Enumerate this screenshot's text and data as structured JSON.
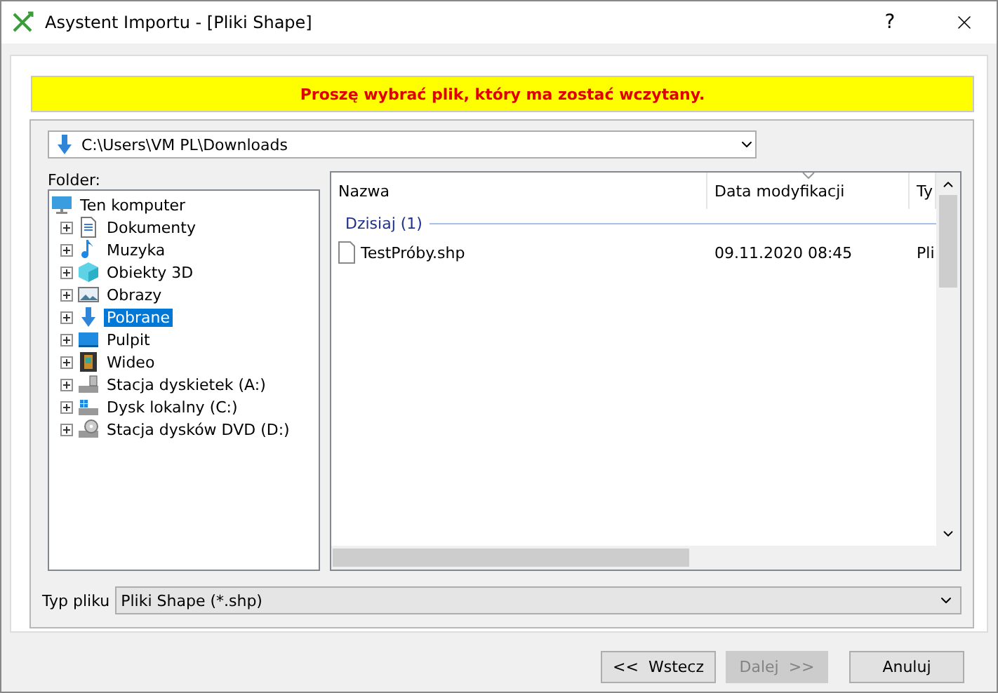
{
  "window": {
    "title": "Asystent Importu - [Pliki Shape]",
    "help": "?"
  },
  "banner": "Proszę wybrać plik, który ma zostać wczytany.",
  "path": {
    "value": "C:\\Users\\VM PL\\Downloads"
  },
  "folder_label": "Folder:",
  "tree": [
    {
      "label": "Ten komputer",
      "kind": "computer",
      "selected": false,
      "children": [
        {
          "label": "Dokumenty",
          "kind": "document",
          "selected": false
        },
        {
          "label": "Muzyka",
          "kind": "music",
          "selected": false
        },
        {
          "label": "Obiekty 3D",
          "kind": "cube",
          "selected": false
        },
        {
          "label": "Obrazy",
          "kind": "image",
          "selected": false
        },
        {
          "label": "Pobrane",
          "kind": "download",
          "selected": true
        },
        {
          "label": "Pulpit",
          "kind": "desktop",
          "selected": false
        },
        {
          "label": "Wideo",
          "kind": "film",
          "selected": false
        },
        {
          "label": "Stacja dyskietek (A:)",
          "kind": "floppy",
          "selected": false
        },
        {
          "label": "Dysk lokalny (C:)",
          "kind": "drive",
          "selected": false
        },
        {
          "label": "Stacja dysków DVD (D:)",
          "kind": "dvd",
          "selected": false
        }
      ]
    }
  ],
  "files": {
    "columns": [
      {
        "label": "Nazwa",
        "sorted": false
      },
      {
        "label": "Data modyfikacji",
        "sorted": true
      },
      {
        "label": "Ty",
        "sorted": false
      }
    ],
    "group": "Dzisiaj (1)",
    "rows": [
      {
        "name": "TestPróby.shp",
        "date": "09.11.2020 08:45",
        "type": "Pli"
      }
    ]
  },
  "file_type": {
    "label": "Typ pliku",
    "value": "Pliki Shape (*.shp)"
  },
  "buttons": [
    {
      "label": "<<  Wstecz",
      "disabled": false
    },
    {
      "label": "Dalej  >>",
      "disabled": true
    },
    {
      "label": "Anuluj",
      "disabled": false
    }
  ]
}
